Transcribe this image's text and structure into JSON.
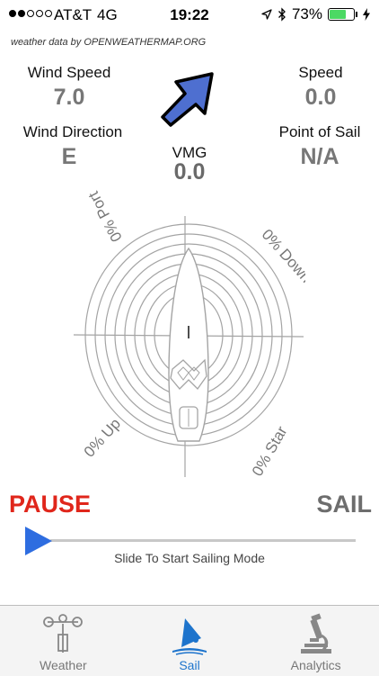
{
  "status_bar": {
    "carrier": "AT&T",
    "network": "4G",
    "time": "19:22",
    "battery": "73%",
    "battery_level": 0.73
  },
  "attribution": "weather data by OPENWEATHERMAP.ORG",
  "metrics": {
    "wind_speed_label": "Wind Speed",
    "wind_speed_value": "7.0",
    "speed_label": "Speed",
    "speed_value": "0.0",
    "wind_direction_label": "Wind Direction",
    "wind_direction_value": "E",
    "vmg_label": "VMG",
    "vmg_value": "0.0",
    "point_of_sail_label": "Point of Sail",
    "point_of_sail_value": "N/A"
  },
  "polar": {
    "port": "0% Port",
    "down": "0% Down",
    "up": "0% Up",
    "star": "0% Star"
  },
  "controls": {
    "pause_label": "PAUSE",
    "sail_label": "SAIL",
    "slider_hint": "Slide To Start Sailing Mode"
  },
  "tabs": [
    {
      "label": "Weather",
      "icon": "anemometer-icon",
      "active": false
    },
    {
      "label": "Sail",
      "icon": "windsurfer-icon",
      "active": true
    },
    {
      "label": "Analytics",
      "icon": "microscope-icon",
      "active": false
    }
  ],
  "colors": {
    "accent": "#1e74cc",
    "pause": "#e0261b",
    "arrow": "#4e6fd0",
    "battery": "#4cd964"
  }
}
